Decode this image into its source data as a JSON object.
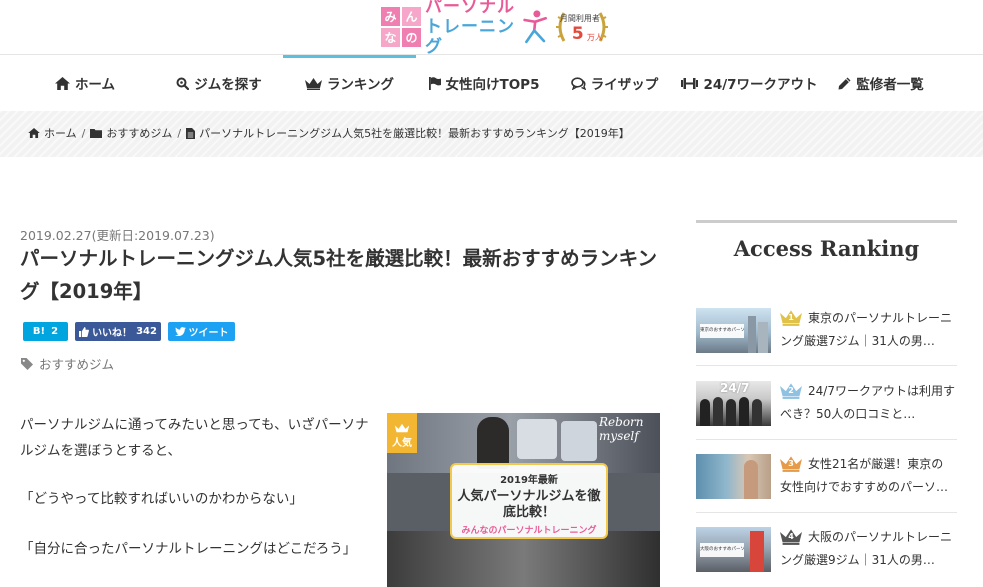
{
  "header": {
    "logo_tiles": [
      "み",
      "ん",
      "な",
      "の"
    ],
    "logo_line1": "パーソナル",
    "logo_line2": "トレーニング",
    "badge_top": "月間利用者",
    "badge_num": "5",
    "badge_unit": "万人",
    "colors": {
      "pink": "#e85b98",
      "blue": "#4aa6d9",
      "gold": "#c9a33b"
    }
  },
  "nav": {
    "items": [
      {
        "label": "ホーム",
        "icon": "home-icon"
      },
      {
        "label": "ジムを探す",
        "icon": "search-icon"
      },
      {
        "label": "ランキング",
        "icon": "crown-icon",
        "active": true
      },
      {
        "label": "女性向けTOP5",
        "icon": "flag-icon"
      },
      {
        "label": "ライザップ",
        "icon": "chat-icon"
      },
      {
        "label": "24/7ワークアウト",
        "icon": "dumbbell-icon"
      },
      {
        "label": "監修者一覧",
        "icon": "pencil-icon"
      }
    ],
    "active_color": "#5bc0de"
  },
  "breadcrumb": [
    {
      "label": "ホーム",
      "icon": "home-icon"
    },
    {
      "label": "おすすめジム",
      "icon": "folder-icon"
    },
    {
      "label": "パーソナルトレーニングジム人気5社を厳選比較！最新おすすめランキング【2019年】",
      "icon": "file-icon"
    }
  ],
  "post": {
    "date": "2019.02.27(更新日:2019.07.23)",
    "title": "パーソナルトレーニングジム人気5社を厳選比較！最新おすすめランキング【2019年】",
    "share": {
      "hatena_count": "2",
      "fb_label": "いいね！",
      "fb_count": "342",
      "tweet_label": "ツイート",
      "colors": {
        "hatena": "#00a4de",
        "facebook": "#3b5998",
        "twitter": "#1da1f2"
      }
    },
    "category": "おすすめジム",
    "paragraphs": [
      "パーソナルジムに通ってみたいと思っても、いざパーソナルジムを選ぼうとすると、",
      "「どうやって比較すればいいのかわからない」",
      "「自分に合ったパーソナルトレーニングはどこだろう」"
    ],
    "feature_image": {
      "ribbon": "人気",
      "corner_text": "Reborn myself",
      "card_top": "2019年最新",
      "card_main": "人気パーソナルジムを徹底比較！",
      "card_brand": "みんなのパーソナルトレーニング"
    }
  },
  "sidebar": {
    "title": "Access Ranking",
    "items": [
      {
        "rank": "1",
        "text": "東京のパーソナルトレーニング厳選7ジム｜31人の男…",
        "crown_color": "#e0c24a",
        "thumb_caption": "東京のおすすめパーソナルジム7選"
      },
      {
        "rank": "2",
        "text": "24/7ワークアウトは利用すべき？50人の口コミと…",
        "crown_color": "#8fc1e3",
        "thumb_caption": "24/7"
      },
      {
        "rank": "3",
        "text": "女性21名が厳選！東京の女性向けでおすすめのパーソ…",
        "crown_color": "#e59b4a",
        "thumb_caption": ""
      },
      {
        "rank": "4",
        "text": "大阪のパーソナルトレーニング厳選9ジム｜31人の男…",
        "crown_color": "#555555",
        "thumb_caption": "大阪のおすすめパーソナルジム"
      }
    ]
  }
}
